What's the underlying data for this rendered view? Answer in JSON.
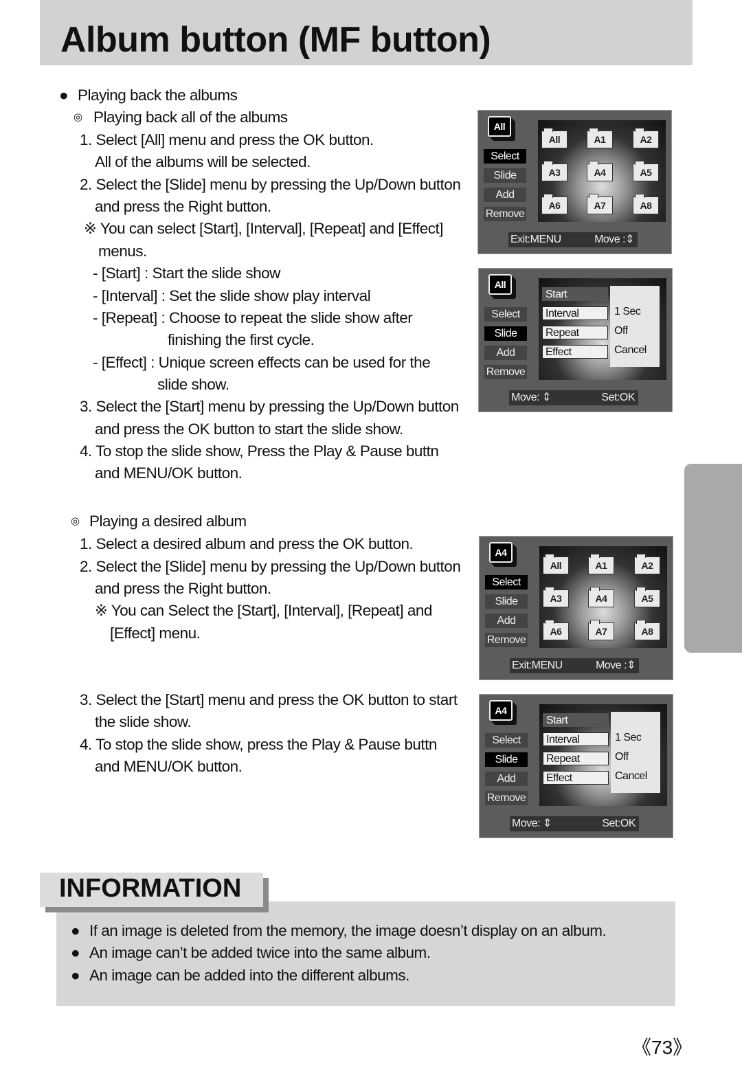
{
  "title": "Album button (MF button)",
  "section1": {
    "heading": "Playing back the albums",
    "sub1": "Playing back all of the albums",
    "lines": [
      "1. Select [All] menu and press the OK button.",
      "All of the albums will be selected.",
      "2. Select the [Slide] menu by pressing the Up/Down button",
      "and press the Right button.",
      "※ You can select [Start], [Interval], [Repeat] and [Effect]",
      "menus.",
      "- [Start] : Start the slide show",
      "- [Interval] : Set the slide show play interval",
      "- [Repeat] : Choose to repeat the slide show after",
      "finishing the first cycle.",
      "- [Effect] : Unique screen effects can be used for the",
      "slide show.",
      "3. Select the [Start] menu by pressing the Up/Down button",
      "and press the OK button to start the slide show.",
      "4. To stop the slide show, Press the Play & Pause buttn",
      "and MENU/OK button."
    ],
    "sub2": "Playing a desired album",
    "lines2": [
      "1. Select a desired album and press the OK button.",
      "2. Select the [Slide] menu by pressing the Up/Down button",
      "and press the Right button.",
      "※ You can Select the [Start], [Interval], [Repeat] and",
      "[Effect] menu.",
      "3. Select the [Start] menu and press the OK button to start",
      "the slide show.",
      "4. To stop the slide show, press the Play & Pause buttn",
      "and MENU/OK button."
    ]
  },
  "screens": [
    {
      "type": "grid",
      "album": "All",
      "menu": [
        "Select",
        "Slide",
        "Add",
        "Remove"
      ],
      "selected": 0,
      "folders": [
        "All",
        "A1",
        "A2",
        "A3",
        "A4",
        "A5",
        "A6",
        "A7",
        "A8"
      ],
      "bar_left": "Exit:MENU",
      "bar_right": "Move :⇕"
    },
    {
      "type": "slide",
      "album": "All",
      "menu": [
        "Select",
        "Slide",
        "Add",
        "Remove"
      ],
      "selected": 1,
      "submenu": [
        "Start",
        "Interval",
        "Repeat",
        "Effect"
      ],
      "values": [
        "1 Sec",
        "Off",
        "Cancel"
      ],
      "bar_left": "Move: ⇕",
      "bar_right": "Set:OK"
    },
    {
      "type": "grid",
      "album": "A4",
      "menu": [
        "Select",
        "Slide",
        "Add",
        "Remove"
      ],
      "selected": 0,
      "folders": [
        "All",
        "A1",
        "A2",
        "A3",
        "A4",
        "A5",
        "A6",
        "A7",
        "A8"
      ],
      "bar_left": "Exit:MENU",
      "bar_right": "Move :⇕"
    },
    {
      "type": "slide",
      "album": "A4",
      "menu": [
        "Select",
        "Slide",
        "Add",
        "Remove"
      ],
      "selected": 1,
      "submenu": [
        "Start",
        "Interval",
        "Repeat",
        "Effect"
      ],
      "values": [
        "1 Sec",
        "Off",
        "Cancel"
      ],
      "bar_left": "Move: ⇕",
      "bar_right": "Set:OK"
    }
  ],
  "information": {
    "heading": "INFORMATION",
    "items": [
      "If an image is deleted from the memory, the image doesn’t display on an album.",
      "An image can’t be added twice into the same album.",
      "An image can be added into the different albums."
    ]
  },
  "page_number": "《73》"
}
